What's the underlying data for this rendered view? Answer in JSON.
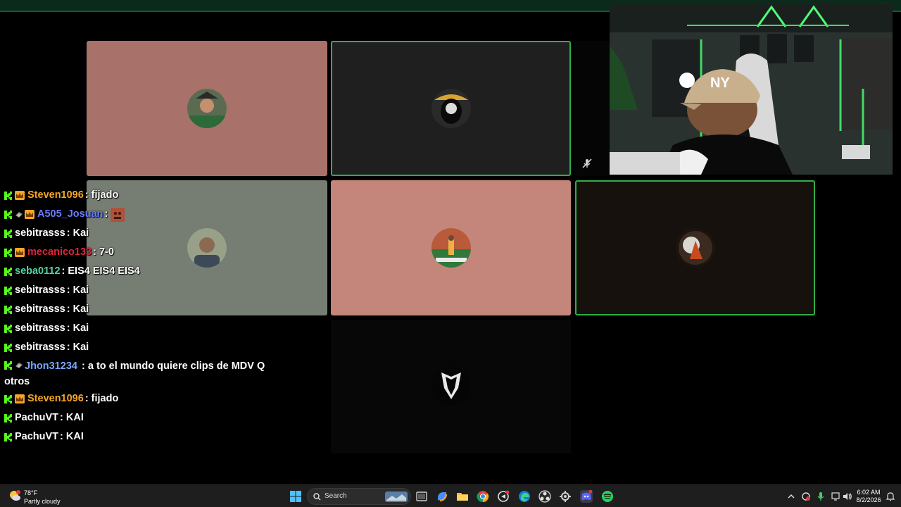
{
  "chat": {
    "messages": [
      {
        "badges": [
          "kick",
          "crown"
        ],
        "user": "Steven1096",
        "color": "#f5a623",
        "text": ": fijado"
      },
      {
        "badges": [
          "kick",
          "gem",
          "crown"
        ],
        "user": "A505_Josuan",
        "color": "#6a7bff",
        "text": ":",
        "emote": "face-emote"
      },
      {
        "badges": [
          "kick"
        ],
        "user": "sebitrasss",
        "color": "#ffffff",
        "text": ": Kai"
      },
      {
        "badges": [
          "kick",
          "crown"
        ],
        "user": "mecanico133",
        "color": "#e0253a",
        "text": ": 7-0"
      },
      {
        "badges": [
          "kick"
        ],
        "user": "seba0112",
        "color": "#55d3a0",
        "text": ": EIS4 EIS4 EIS4"
      },
      {
        "badges": [
          "kick"
        ],
        "user": "sebitrasss",
        "color": "#ffffff",
        "text": ": Kai"
      },
      {
        "badges": [
          "kick"
        ],
        "user": "sebitrasss",
        "color": "#ffffff",
        "text": ": Kai"
      },
      {
        "badges": [
          "kick"
        ],
        "user": "sebitrasss",
        "color": "#ffffff",
        "text": ": Kai"
      },
      {
        "badges": [
          "kick"
        ],
        "user": "sebitrasss",
        "color": "#ffffff",
        "text": ": Kai"
      },
      {
        "badges": [
          "kick",
          "gem"
        ],
        "user": "Jhon31234",
        "color": "#79a8ff",
        "text": ": a to el mundo quiere clips de MDV Q otros"
      },
      {
        "badges": [
          "kick",
          "crown"
        ],
        "user": "Steven1096",
        "color": "#f5a623",
        "text": ": fijado"
      },
      {
        "badges": [
          "kick"
        ],
        "user": "PachuVT",
        "color": "#ffffff",
        "text": ": KAI"
      },
      {
        "badges": [
          "kick"
        ],
        "user": "PachuVT",
        "color": "#ffffff",
        "text": ": KAI"
      }
    ]
  },
  "taskbar": {
    "weather_temp": "78°F",
    "weather_desc": "Partly cloudy",
    "search_placeholder": "Search",
    "time": "6:02 AM",
    "date": "8/2/2026"
  },
  "colors": {
    "kick_green": "#53fc18",
    "speaking_border": "#2fae4c",
    "tile_rose": "#a8716a",
    "tile_salmon": "#c4857b",
    "tile_grey": "#767d73",
    "tile_dark": "#1f1f1f",
    "tile_brown": "#16110c"
  }
}
